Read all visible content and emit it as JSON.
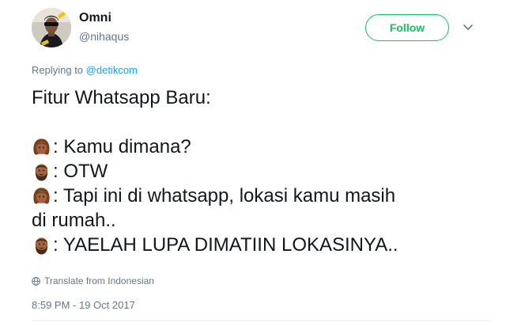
{
  "author": {
    "name": "Omni",
    "handle": "@nihaqus",
    "avatar_icon": "user-avatar"
  },
  "follow_label": "Follow",
  "replying": {
    "prefix": "Replying to ",
    "mention": "@detikcom"
  },
  "tweet_lines": [
    {
      "emoji": "",
      "text": "Fitur Whatsapp Baru:"
    },
    {
      "emoji": "",
      "text": ""
    },
    {
      "emoji": "woman-emoji",
      "text": ": Kamu dimana?"
    },
    {
      "emoji": "bearded-man-emoji",
      "text": ": OTW"
    },
    {
      "emoji": "woman-emoji",
      "text": ": Tapi ini di whatsapp, lokasi kamu masih"
    },
    {
      "emoji": "",
      "text": "di rumah.."
    },
    {
      "emoji": "bearded-man-emoji",
      "text": ": YAELAH LUPA DIMATIIN LOKASINYA.."
    }
  ],
  "translate_label": "Translate from Indonesian",
  "timestamp": "8:59 PM - 19 Oct 2017",
  "colors": {
    "accent_green": "#17bf63",
    "link_blue": "#1da1f2",
    "muted_gray": "#657786",
    "text": "#14171a"
  }
}
